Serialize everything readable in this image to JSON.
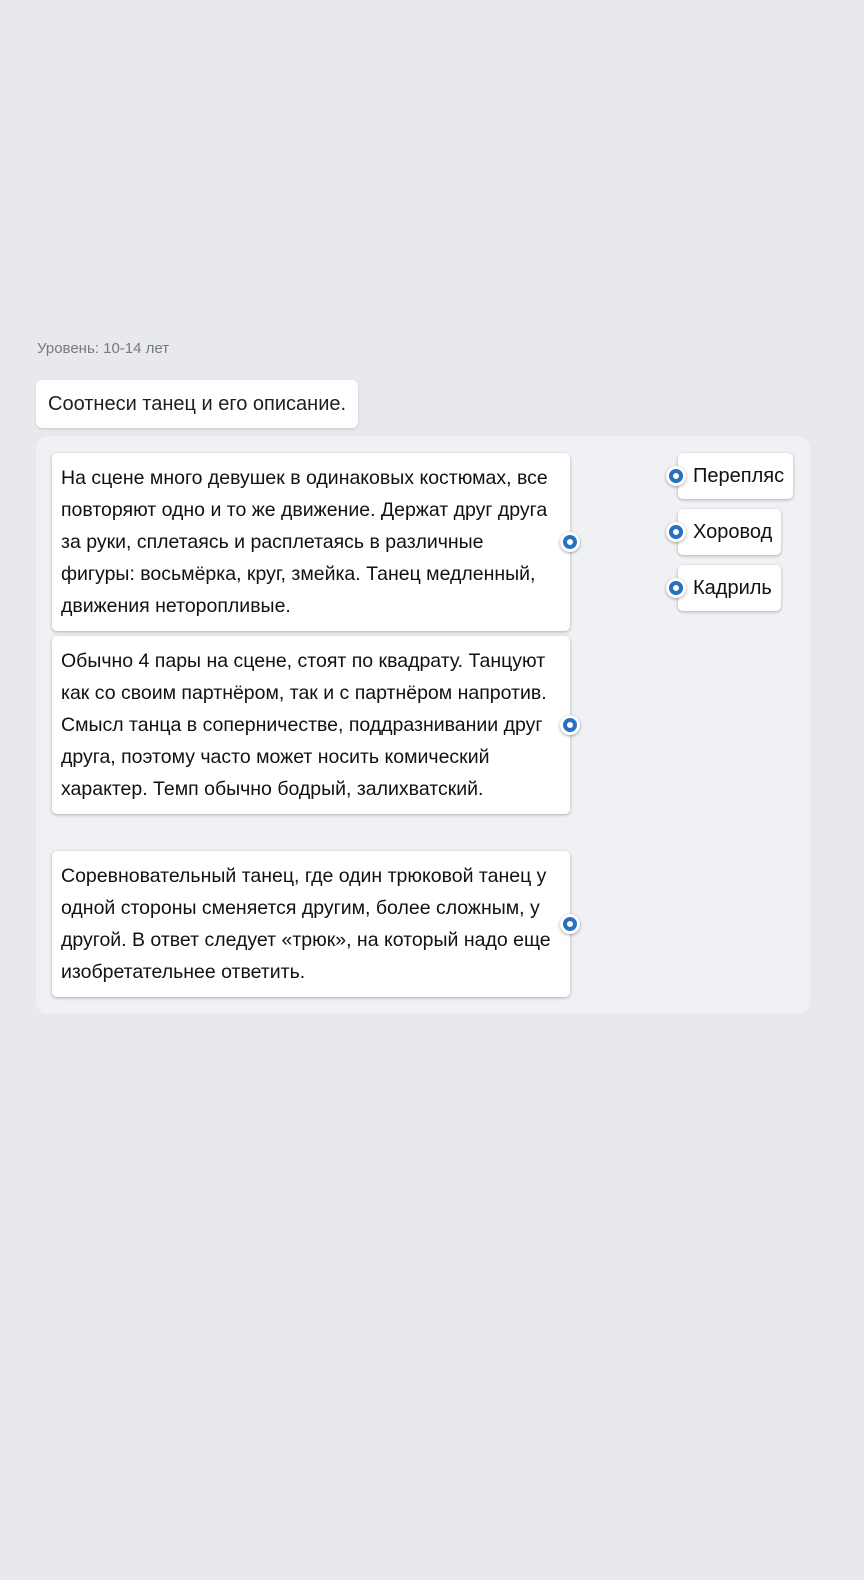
{
  "level": "Уровень: 10-14 лет",
  "question": "Соотнеси танец и его описание.",
  "descriptions": [
    {
      "text": "На сцене много девушек в одинаковых костюмах, все повторяют одно и то же движение. Держат друг друга за руки, сплетаясь и расплетаясь в различные фигуры: восьмёрка, круг, змейка. Танец медленный, движения неторопливые."
    },
    {
      "text": "Обычно 4 пары на сцене, стоят по квадрату. Танцуют как со своим партнёром, так и с партнёром напротив. Смысл танца в соперничестве, поддразнивании друг друга, поэтому часто может носить комический характер. Темп обычно бодрый, залихватский."
    },
    {
      "text": "Соревновательный танец, где один трюковой танец у одной стороны сменяется другим, более сложным, у другой. В ответ следует «трюк», на который надо еще изобретательнее ответить."
    }
  ],
  "options": [
    {
      "label": "Перепляс"
    },
    {
      "label": "Хоровод"
    },
    {
      "label": "Кадриль"
    }
  ],
  "colors": {
    "background": "#e8e9ed",
    "panel": "#f0f1f4",
    "connector_accent": "#2a6fc0"
  }
}
